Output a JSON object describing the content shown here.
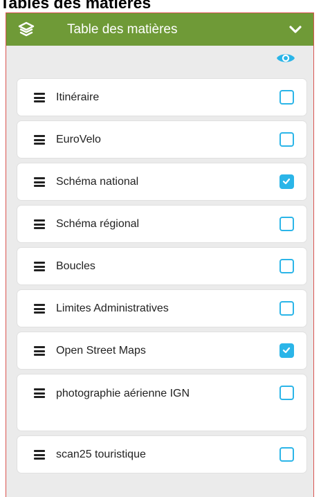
{
  "page": {
    "heading": "Tables des matières"
  },
  "toc": {
    "title": "Table des matières",
    "header_color": "#6f9a37",
    "icons": {
      "header_left": "layers-icon",
      "header_right": "chevron-down-icon",
      "visibility_column": "eye-icon"
    },
    "layers": [
      {
        "label": "Itinéraire",
        "checked": false
      },
      {
        "label": "EuroVelo",
        "checked": false
      },
      {
        "label": "Schéma national",
        "checked": true
      },
      {
        "label": "Schéma régional",
        "checked": false
      },
      {
        "label": "Boucles",
        "checked": false
      },
      {
        "label": "Limites Administratives",
        "checked": false
      },
      {
        "label": "Open Street Maps",
        "checked": true
      },
      {
        "label": "photographie aérienne IGN",
        "checked": false
      },
      {
        "label": "scan25 touristique",
        "checked": false
      }
    ],
    "checkbox_color": "#2bb5e8"
  }
}
